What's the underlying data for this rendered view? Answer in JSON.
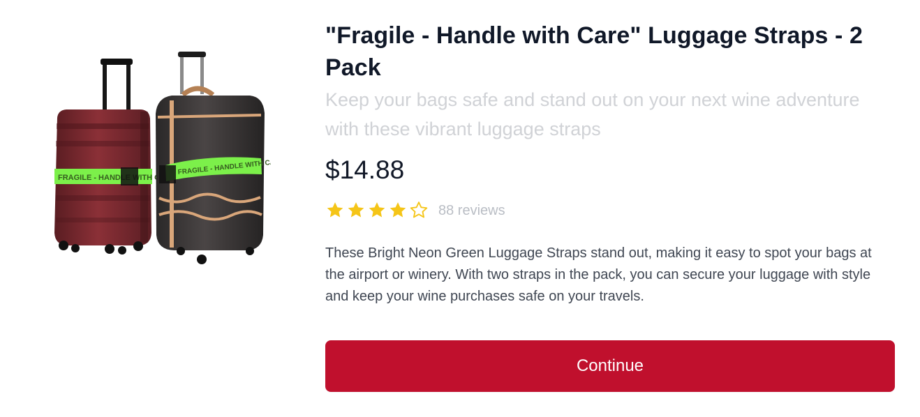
{
  "product": {
    "title": "\"Fragile - Handle with Care\" Luggage Straps - 2 Pack",
    "subtitle": "Keep your bags safe and stand out on your next wine adventure with these vibrant luggage straps",
    "price": "$14.88",
    "rating": {
      "value": 4,
      "max": 5,
      "reviews_text": "88 reviews"
    },
    "description": "These Bright Neon Green Luggage Straps stand out, making it easy to spot your bags at the airport or winery. With two straps in the pack, you can secure your luggage with style and keep your wine purchases safe on your travels.",
    "image": {
      "strap_text": "FRAGILE - HANDLE WITH CARE"
    }
  },
  "actions": {
    "continue_label": "Continue"
  },
  "colors": {
    "accent": "#c0102d",
    "star": "#f5c518",
    "strap": "#7cf04a"
  }
}
